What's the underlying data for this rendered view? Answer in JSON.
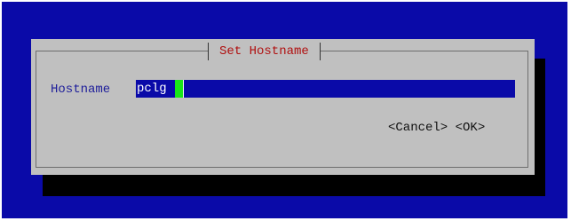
{
  "dialog": {
    "title": "Set Hostname",
    "field_label": "Hostname",
    "field_value": "pclg",
    "cancel_label": "<Cancel>",
    "ok_label": "<OK>"
  },
  "colors": {
    "background": "#0a0aa8",
    "dialog": "#c0c0c0",
    "title_text": "#b01010",
    "label_text": "#1d1d9a",
    "field_bg": "#0a0aa8",
    "cursor": "#19e619"
  }
}
